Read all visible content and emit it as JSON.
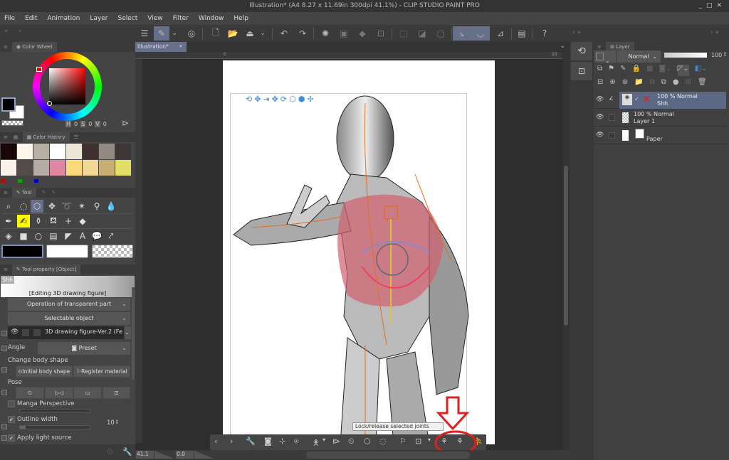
{
  "window": {
    "title": "Illustration* (A4 8.27 x 11.69in 300dpi 41.1%)  - CLIP STUDIO PAINT PRO",
    "controls": [
      "_",
      "□",
      "✕"
    ]
  },
  "menu": [
    "File",
    "Edit",
    "Animation",
    "Layer",
    "Select",
    "View",
    "Filter",
    "Window",
    "Help"
  ],
  "toolbar": {
    "icons": [
      "menu-icon",
      "edit-icon",
      "chevron-down-icon",
      "clip-studio-icon",
      "new-file-icon",
      "open-folder-icon",
      "save-icon",
      "chevron-down-icon",
      "undo-icon",
      "redo-icon",
      "loading-icon",
      "clear-icon",
      "fill-icon",
      "transform-icon",
      "deselect-icon",
      "invert-selection-icon",
      "selection-border-icon",
      "snap-ruler-icon",
      "snap-special-ruler-icon",
      "snap-grid-icon",
      "companion-icon",
      "help-icon"
    ]
  },
  "color_wheel": {
    "tab_label": "Color Wheel",
    "h_label": "H",
    "h_value": "0",
    "s_label": "S",
    "s_value": "0",
    "v_label": "V",
    "v_value": "0",
    "main_color": "#000000",
    "sub_color": "#ffffff"
  },
  "color_history": {
    "tab_label": "Color History",
    "swatches": [
      "#170708",
      "#fff7ec",
      "#b8afa4",
      "#ffffff",
      "#ede5d5",
      "#3f2f31",
      "#928a81",
      "#3e3536",
      "#fdf2ea",
      "#544c48",
      "#b6aca6",
      "#de87a2",
      "#fed97a",
      "#f2d894",
      "#c8ae73",
      "#e3de65"
    ],
    "mini": [
      "#cc0000",
      "#00aa00",
      "#0000cc"
    ]
  },
  "tool_panel": {
    "tab_label": "Tool",
    "rows": [
      [
        "zoom-icon",
        "lasso-select-icon",
        "object-select-icon",
        "move-icon",
        "lasso-icon",
        "magic-wand-icon",
        "eyedropper-icon",
        "blend-icon"
      ],
      [
        "pen-icon",
        "brush-icon",
        "airbrush-icon",
        "decoration-icon",
        "sparkle-icon",
        "eraser-icon"
      ],
      [
        "fill-icon",
        "gradient-icon",
        "shape-icon",
        "frame-icon",
        "ruler-icon",
        "text-icon",
        "balloon-icon",
        "correct-line-icon"
      ]
    ],
    "colors": [
      "#000000",
      "#ffffff",
      "transparent"
    ]
  },
  "tool_property": {
    "tab_label": "Tool property [Object]",
    "preview_name": "Shh",
    "editing_label": "[Editing 3D drawing figure]",
    "transparent_op": "Operation of transparent part",
    "selectable": "Selectable object",
    "figure_name": "3D drawing figure-Ver.2 (Fe",
    "angle_label": "Angle",
    "preset_label": "Preset",
    "body_shape_label": "Change body shape",
    "initial_body": "Initial body shape",
    "register_material": "Register material",
    "pose_label": "Pose",
    "manga_perspective": "Manga Perspective",
    "outline_width": "Outline width",
    "outline_value": "10",
    "outline_checked": true,
    "apply_light": "Apply light source",
    "apply_light_checked": true,
    "manga_checked": false
  },
  "document": {
    "tab_label": "Illustration*",
    "ruler_start": "0",
    "ruler_end": "10",
    "zoom_value": "41.1",
    "rotation_value": "0.0"
  },
  "object_launcher": {
    "tooltip": "Lock/release selected joints",
    "icons": [
      "prev-icon",
      "next-icon",
      "wrench-icon",
      "camera-icon",
      "fit-icon",
      "ground-icon",
      "pose-icon",
      "chevron-down-icon",
      "flip-icon",
      "reset-icon",
      "camera-reset-icon",
      "pose-reset-icon",
      "register-pose-icon",
      "body-pose-icon",
      "chevron-down-icon",
      "lock-joint-icon",
      "release-joint-icon",
      "lock-all-icon"
    ]
  },
  "layer_panel": {
    "tab_label": "Layer",
    "blend_mode": "Normal",
    "opacity": "100",
    "layers": [
      {
        "name": "Shh",
        "meta": "100 % Normal",
        "selected": true,
        "type": "3d"
      },
      {
        "name": "Layer 1",
        "meta": "100 % Normal",
        "selected": false,
        "type": "raster"
      },
      {
        "name": "Paper",
        "meta": "",
        "selected": false,
        "type": "paper"
      }
    ]
  },
  "annotation": {
    "color": "#e02020"
  }
}
